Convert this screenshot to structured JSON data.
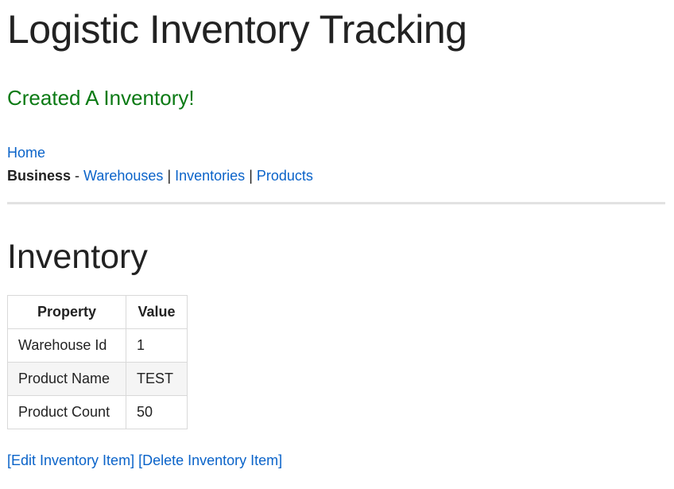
{
  "header": {
    "title": "Logistic Inventory Tracking"
  },
  "flash": {
    "message": "Created A Inventory!",
    "color": "#0b7a14"
  },
  "nav": {
    "home_label": "Home",
    "business_label": "Business",
    "separator_dash": " - ",
    "separator_pipe": " | ",
    "links": [
      {
        "label": "Warehouses"
      },
      {
        "label": "Inventories"
      },
      {
        "label": "Products"
      }
    ],
    "link_color": "#0a63c9"
  },
  "main": {
    "section_title": "Inventory",
    "table": {
      "headers": [
        "Property",
        "Value"
      ],
      "rows": [
        {
          "property": "Warehouse Id",
          "value": "1"
        },
        {
          "property": "Product Name",
          "value": "TEST"
        },
        {
          "property": "Product Count",
          "value": "50"
        }
      ]
    },
    "actions": {
      "edit_label": "[Edit Inventory Item]",
      "delete_label": "[Delete Inventory Item]"
    }
  }
}
